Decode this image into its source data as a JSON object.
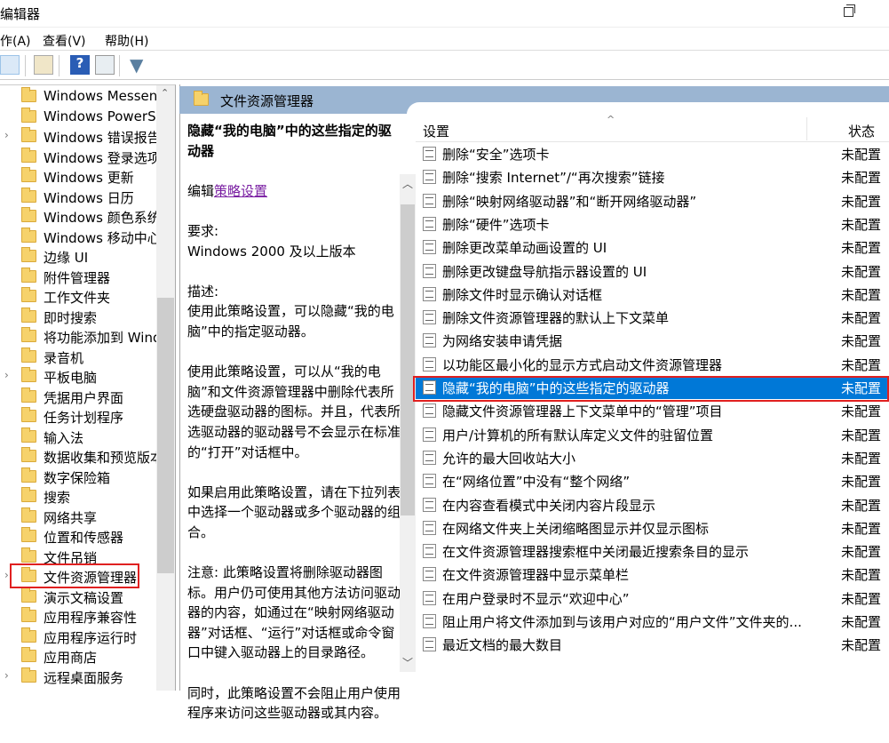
{
  "window": {
    "title": "编辑器"
  },
  "menu": [
    "作(A)",
    "查看(V)",
    "帮助(H)"
  ],
  "tree": [
    {
      "label": "Windows Messenger",
      "chev": false
    },
    {
      "label": "Windows PowerShell",
      "chev": false
    },
    {
      "label": "Windows 错误报告",
      "chev": true
    },
    {
      "label": "Windows 登录选项",
      "chev": false
    },
    {
      "label": "Windows 更新",
      "chev": false
    },
    {
      "label": "Windows 日历",
      "chev": false
    },
    {
      "label": "Windows 颜色系统",
      "chev": false
    },
    {
      "label": "Windows 移动中心",
      "chev": false
    },
    {
      "label": "边缘 UI",
      "chev": false
    },
    {
      "label": "附件管理器",
      "chev": false
    },
    {
      "label": "工作文件夹",
      "chev": false
    },
    {
      "label": "即时搜索",
      "chev": false
    },
    {
      "label": "将功能添加到 Windows",
      "chev": false
    },
    {
      "label": "录音机",
      "chev": false
    },
    {
      "label": "平板电脑",
      "chev": true
    },
    {
      "label": "凭据用户界面",
      "chev": false
    },
    {
      "label": "任务计划程序",
      "chev": false
    },
    {
      "label": "输入法",
      "chev": false
    },
    {
      "label": "数据收集和预览版本",
      "chev": false
    },
    {
      "label": "数字保险箱",
      "chev": false
    },
    {
      "label": "搜索",
      "chev": false
    },
    {
      "label": "网络共享",
      "chev": false
    },
    {
      "label": "位置和传感器",
      "chev": false
    },
    {
      "label": "文件吊销",
      "chev": false
    },
    {
      "label": "文件资源管理器",
      "chev": true
    },
    {
      "label": "演示文稿设置",
      "chev": false
    },
    {
      "label": "应用程序兼容性",
      "chev": false
    },
    {
      "label": "应用程序运行时",
      "chev": false
    },
    {
      "label": "应用商店",
      "chev": false
    },
    {
      "label": "远程桌面服务",
      "chev": true
    }
  ],
  "pane": {
    "title": "文件资源管理器"
  },
  "desc": {
    "heading": "隐藏“我的电脑”中的这些指定的驱动器",
    "edit_prefix": "编辑",
    "edit_link": "策略设置",
    "req_label": "要求:",
    "req_value": "Windows 2000 及以上版本",
    "desc_label": "描述:",
    "p1": "使用此策略设置，可以隐藏“我的电脑”中的指定驱动器。",
    "p2": "使用此策略设置，可以从“我的电脑”和文件资源管理器中删除代表所选硬盘驱动器的图标。并且，代表所选驱动器的驱动器号不会显示在标准的“打开”对话框中。",
    "p3": "如果启用此策略设置，请在下拉列表中选择一个驱动器或多个驱动器的组合。",
    "p4": "注意: 此策略设置将删除驱动器图标。用户仍可使用其他方法访问驱动器的内容，如通过在“映射网络驱动器”对话框、“运行”对话框或命令窗口中键入驱动器上的目录路径。",
    "p5": "同时，此策略设置不会阻止用户使用程序来访问这些驱动器或其内容。"
  },
  "list": {
    "col_setting": "设置",
    "col_state": "状态",
    "rows": [
      {
        "name": "删除“安全”选项卡",
        "state": "未配置"
      },
      {
        "name": "删除“搜索 Internet”/“再次搜索”链接",
        "state": "未配置"
      },
      {
        "name": "删除“映射网络驱动器”和“断开网络驱动器”",
        "state": "未配置"
      },
      {
        "name": "删除“硬件”选项卡",
        "state": "未配置"
      },
      {
        "name": "删除更改菜单动画设置的 UI",
        "state": "未配置"
      },
      {
        "name": "删除更改键盘导航指示器设置的 UI",
        "state": "未配置"
      },
      {
        "name": "删除文件时显示确认对话框",
        "state": "未配置"
      },
      {
        "name": "删除文件资源管理器的默认上下文菜单",
        "state": "未配置"
      },
      {
        "name": "为网络安装申请凭据",
        "state": "未配置"
      },
      {
        "name": "以功能区最小化的显示方式启动文件资源管理器",
        "state": "未配置"
      },
      {
        "name": "隐藏“我的电脑”中的这些指定的驱动器",
        "state": "未配置",
        "selected": true
      },
      {
        "name": "隐藏文件资源管理器上下文菜单中的“管理”项目",
        "state": "未配置"
      },
      {
        "name": "用户/计算机的所有默认库定义文件的驻留位置",
        "state": "未配置"
      },
      {
        "name": "允许的最大回收站大小",
        "state": "未配置"
      },
      {
        "name": "在“网络位置”中没有“整个网络”",
        "state": "未配置"
      },
      {
        "name": "在内容查看模式中关闭内容片段显示",
        "state": "未配置"
      },
      {
        "name": "在网络文件夹上关闭缩略图显示并仅显示图标",
        "state": "未配置"
      },
      {
        "name": "在文件资源管理器搜索框中关闭最近搜索条目的显示",
        "state": "未配置"
      },
      {
        "name": "在文件资源管理器中显示菜单栏",
        "state": "未配置"
      },
      {
        "name": "在用户登录时不显示“欢迎中心”",
        "state": "未配置"
      },
      {
        "name": "阻止用户将文件添加到与该用户对应的“用户文件”文件夹的...",
        "state": "未配置"
      },
      {
        "name": "最近文档的最大数目",
        "state": "未配置"
      }
    ]
  },
  "colors": {
    "selection": "#0078d7",
    "header": "#9bb5d2",
    "highlight_box": "#e02020"
  }
}
